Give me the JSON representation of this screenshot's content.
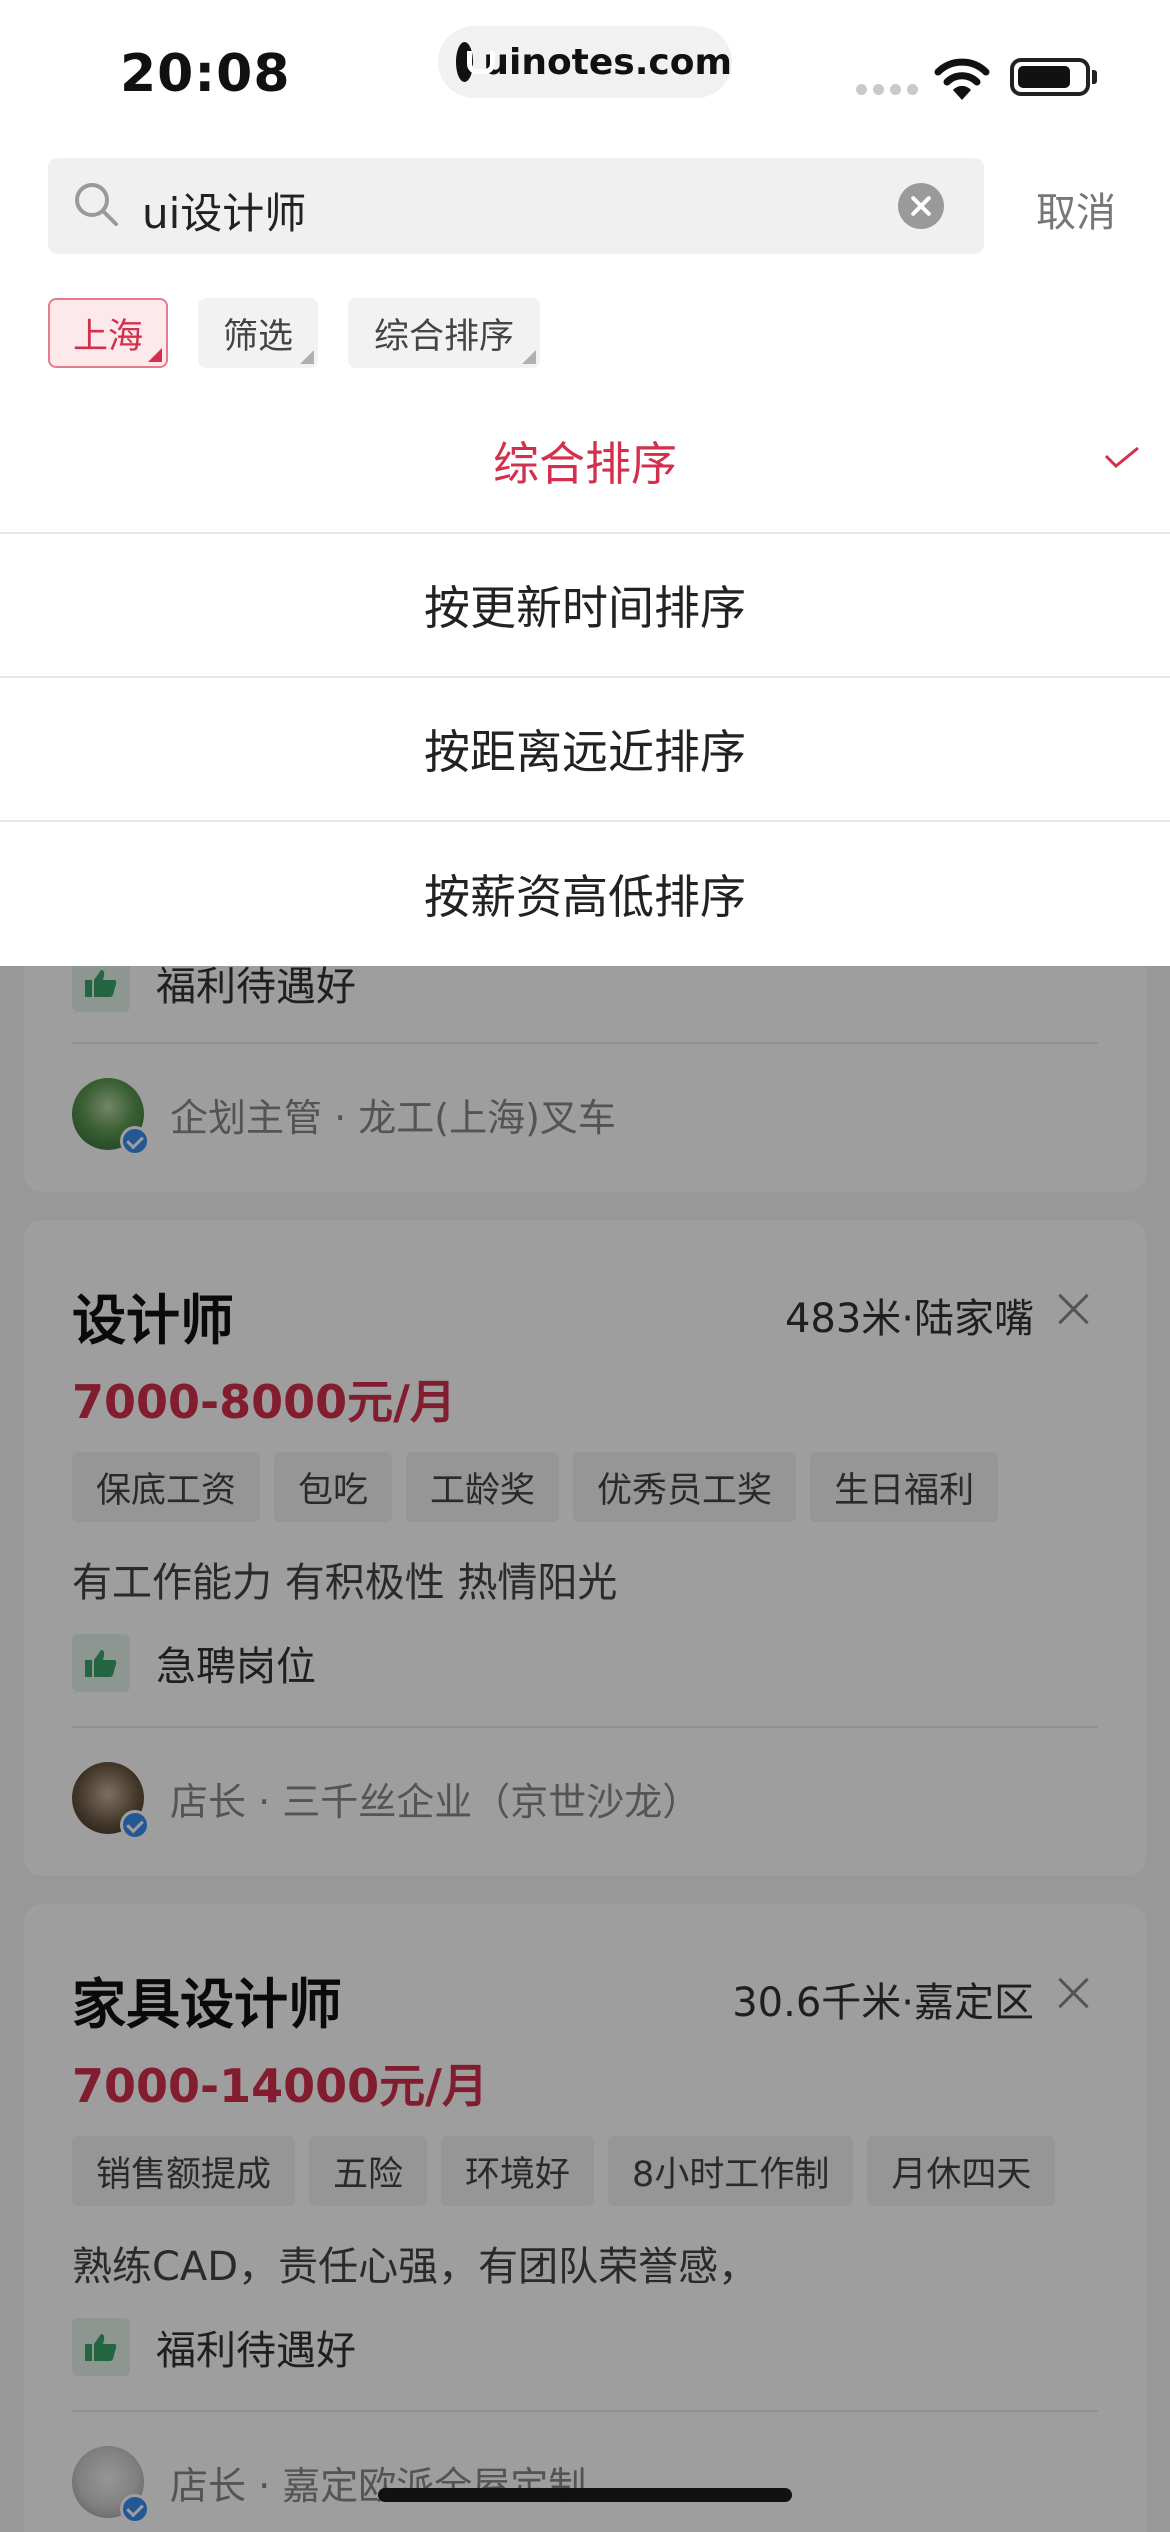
{
  "status_bar": {
    "time": "20:08",
    "url": "uinotes.com"
  },
  "search": {
    "query": "ui设计师",
    "cancel_label": "取消"
  },
  "filters": [
    {
      "label": "上海",
      "active": true
    },
    {
      "label": "筛选",
      "active": false
    },
    {
      "label": "综合排序",
      "active": false
    }
  ],
  "sort_options": [
    {
      "label": "综合排序",
      "selected": true
    },
    {
      "label": "按更新时间排序",
      "selected": false
    },
    {
      "label": "按距离远近排序",
      "selected": false
    },
    {
      "label": "按薪资高低排序",
      "selected": false
    }
  ],
  "jobs": [
    {
      "perk": "福利待遇好",
      "recruiter": "企划主管 · 龙工(上海)叉车"
    },
    {
      "title": "设计师",
      "distance": "483米·陆家嘴",
      "salary": "7000-8000元/月",
      "tags": [
        "保底工资",
        "包吃",
        "工龄奖",
        "优秀员工奖",
        "生日福利"
      ],
      "desc": "有工作能力 有积极性 热情阳光",
      "perk": "急聘岗位",
      "recruiter": "店长 · 三千丝企业（京世沙龙）"
    },
    {
      "title": "家具设计师",
      "distance": "30.6千米·嘉定区",
      "salary": "7000-14000元/月",
      "tags": [
        "销售额提成",
        "五险",
        "环境好",
        "8小时工作制",
        "月休四天"
      ],
      "desc": "熟练CAD，责任心强，有团队荣誉感，",
      "perk": "福利待遇好",
      "recruiter": "店长 · 嘉定欧派全屋定制"
    }
  ],
  "colors": {
    "accent": "#d2304c",
    "perk_green": "#3aa36b"
  }
}
